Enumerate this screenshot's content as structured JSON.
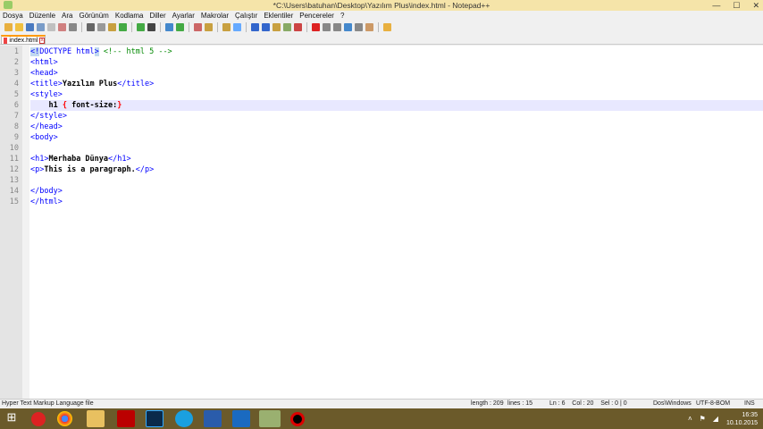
{
  "window": {
    "title": "*C:\\Users\\batuhan\\Desktop\\Yazılım Plus\\index.html - Notepad++",
    "minimize": "—",
    "maximize": "☐",
    "close": "✕"
  },
  "menu": [
    "Dosya",
    "Düzenle",
    "Ara",
    "Görünüm",
    "Kodlama",
    "Diller",
    "Ayarlar",
    "Makrolar",
    "Çalıştır",
    "Eklentiler",
    "Pencereler",
    "?"
  ],
  "tab": {
    "label": "index.html"
  },
  "code": {
    "line_numbers": [
      "1",
      "2",
      "3",
      "4",
      "5",
      "6",
      "7",
      "8",
      "9",
      "10",
      "11",
      "12",
      "13",
      "14",
      "15"
    ],
    "lines": [
      [
        [
          "tag hl",
          "<!"
        ],
        [
          "tag",
          "DOCTYPE html"
        ],
        [
          "tag hl",
          ">"
        ],
        [
          "cm",
          " <!-- html 5 -->"
        ]
      ],
      [
        [
          "tag",
          "<html>"
        ]
      ],
      [
        [
          "tag",
          "<head>"
        ]
      ],
      [
        [
          "tag",
          "<title>"
        ],
        [
          "tx",
          "Yazılım Plus"
        ],
        [
          "tag",
          "</title>"
        ]
      ],
      [
        [
          "tag",
          "<style>"
        ]
      ],
      [
        [
          "tx",
          "    h1 "
        ],
        [
          "br",
          "{"
        ],
        [
          "tx",
          " font-size:"
        ],
        [
          "br",
          "}"
        ]
      ],
      [
        [
          "tag",
          "</style>"
        ]
      ],
      [
        [
          "tag",
          "</head>"
        ]
      ],
      [
        [
          "tag",
          "<body>"
        ]
      ],
      [],
      [
        [
          "tag",
          "<h1>"
        ],
        [
          "tx",
          "Merhaba Dünya"
        ],
        [
          "tag",
          "</h1>"
        ]
      ],
      [
        [
          "tag",
          "<p>"
        ],
        [
          "tx",
          "This is a paragraph."
        ],
        [
          "tag",
          "</p>"
        ]
      ],
      [],
      [
        [
          "tag",
          "</body>"
        ]
      ],
      [
        [
          "tag",
          "</html>"
        ]
      ]
    ]
  },
  "status": {
    "language": "Hyper Text Markup Language file",
    "length": "length : 209",
    "lines": "lines : 15",
    "position": "Ln : 6    Col : 20    Sel : 0 | 0",
    "eol": "Dos\\Windows",
    "encoding": "UTF-8-BOM",
    "mode": "INS"
  },
  "clock": {
    "time": "16:35",
    "date": "10.10.2015"
  }
}
